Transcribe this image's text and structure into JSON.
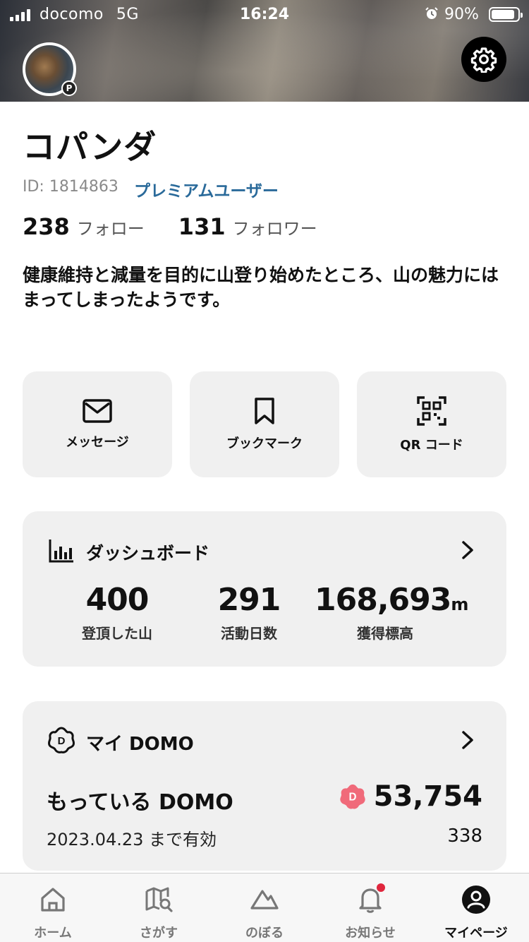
{
  "status_bar": {
    "carrier": "docomo",
    "network": "5G",
    "time": "16:24",
    "battery_percent": "90%",
    "battery_level": 0.9,
    "alarm_icon": "alarm-clock-icon"
  },
  "profile": {
    "name": "コパンダ",
    "id_text": "ID: 1814863",
    "membership": "プレミアムユーザー",
    "badge": "P",
    "following_count": "238",
    "following_label": "フォロー",
    "followers_count": "131",
    "followers_label": "フォロワー",
    "bio": "健康維持と減量を目的に山登り始めたところ、山の魅力にはまってしまったようです。"
  },
  "actions": [
    {
      "label": "メッセージ",
      "icon": "mail-icon"
    },
    {
      "label": "ブックマーク",
      "icon": "bookmark-icon"
    },
    {
      "label": "QR コード",
      "icon": "qr-code-icon"
    }
  ],
  "dashboard": {
    "title": "ダッシュボード",
    "icon": "bar-chart-icon",
    "stats": [
      {
        "value": "400",
        "unit": "",
        "label": "登頂した山"
      },
      {
        "value": "291",
        "unit": "",
        "label": "活動日数"
      },
      {
        "value": "168,693",
        "unit": "m",
        "label": "獲得標高"
      }
    ]
  },
  "my_domo": {
    "title": "マイ DOMO",
    "icon": "domo-flower-icon",
    "have_label": "もっている DOMO",
    "total": "53,754",
    "expiry_label": "2023.04.23 まで有効",
    "expiry_value": "338"
  },
  "bottom_nav": [
    {
      "label": "ホーム",
      "icon": "home-icon",
      "active": false
    },
    {
      "label": "さがす",
      "icon": "map-search-icon",
      "active": false
    },
    {
      "label": "のぼる",
      "icon": "mountain-icon",
      "active": false
    },
    {
      "label": "お知らせ",
      "icon": "bell-icon",
      "active": false,
      "has_badge": true
    },
    {
      "label": "マイページ",
      "icon": "user-circle-icon",
      "active": true
    }
  ],
  "colors": {
    "accent_link": "#2a6a9a",
    "card_bg": "#f0f0f0",
    "domo_pink": "#f06a7a",
    "notification_dot": "#e0263d"
  }
}
